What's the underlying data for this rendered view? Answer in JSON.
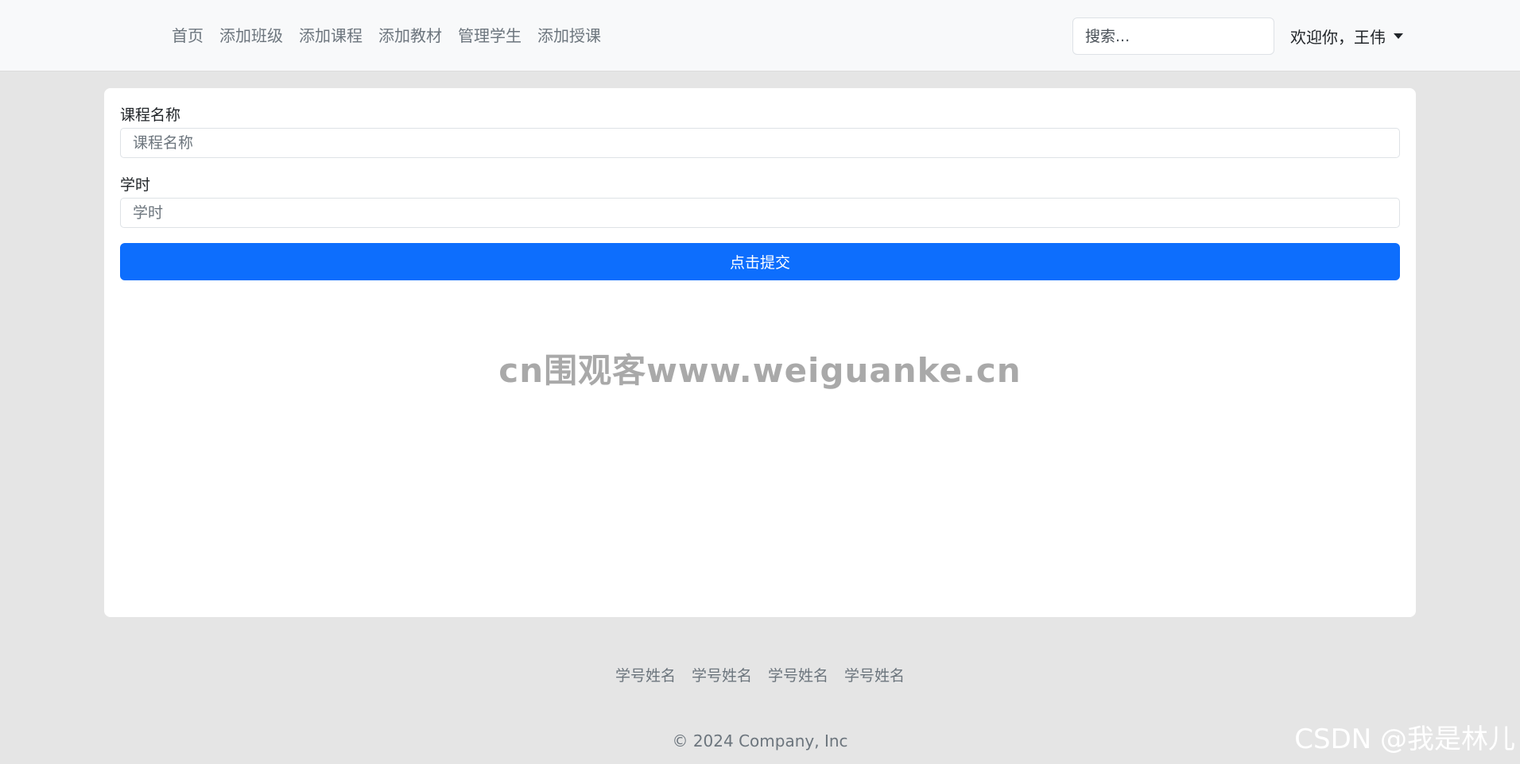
{
  "navbar": {
    "links": [
      "首页",
      "添加班级",
      "添加课程",
      "添加教材",
      "管理学生",
      "添加授课"
    ],
    "search_placeholder": "搜索...",
    "user_label": "欢迎你，王伟"
  },
  "form": {
    "course_name_label": "课程名称",
    "course_name_placeholder": "课程名称",
    "hours_label": "学时",
    "hours_placeholder": "学时",
    "submit_label": "点击提交"
  },
  "watermarks": {
    "center": "cn围观客www.weiguanke.cn",
    "corner": "CSDN @我是林儿"
  },
  "footer": {
    "links": [
      "学号姓名",
      "学号姓名",
      "学号姓名",
      "学号姓名"
    ],
    "copyright": "© 2024 Company, Inc"
  },
  "colors": {
    "primary": "#0d6efd",
    "navbar_bg": "#f8f9fa",
    "page_bg": "#e5e5e5"
  },
  "icons": {
    "user_menu": "caret-down-icon"
  }
}
